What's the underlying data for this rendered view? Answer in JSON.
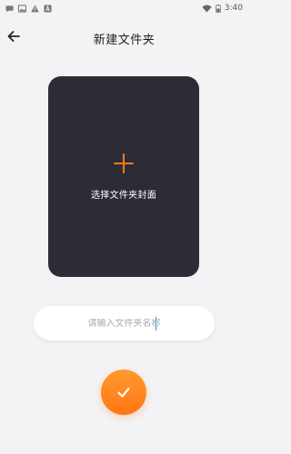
{
  "status_bar": {
    "time": "3:40",
    "icons": [
      "message-icon",
      "image-icon",
      "warning-icon",
      "a-icon",
      "wifi-icon",
      "battery-icon"
    ]
  },
  "header": {
    "title": "新建文件夹",
    "back_icon": "arrow-left-icon"
  },
  "cover_picker": {
    "label": "选择文件夹封面",
    "icon": "plus-icon",
    "accent": "#ff7a1a",
    "background": "#2c2c36"
  },
  "name_input": {
    "placeholder": "请输入文件夹名称",
    "value": ""
  },
  "confirm": {
    "icon": "check-icon",
    "color": "#ff8a22"
  }
}
